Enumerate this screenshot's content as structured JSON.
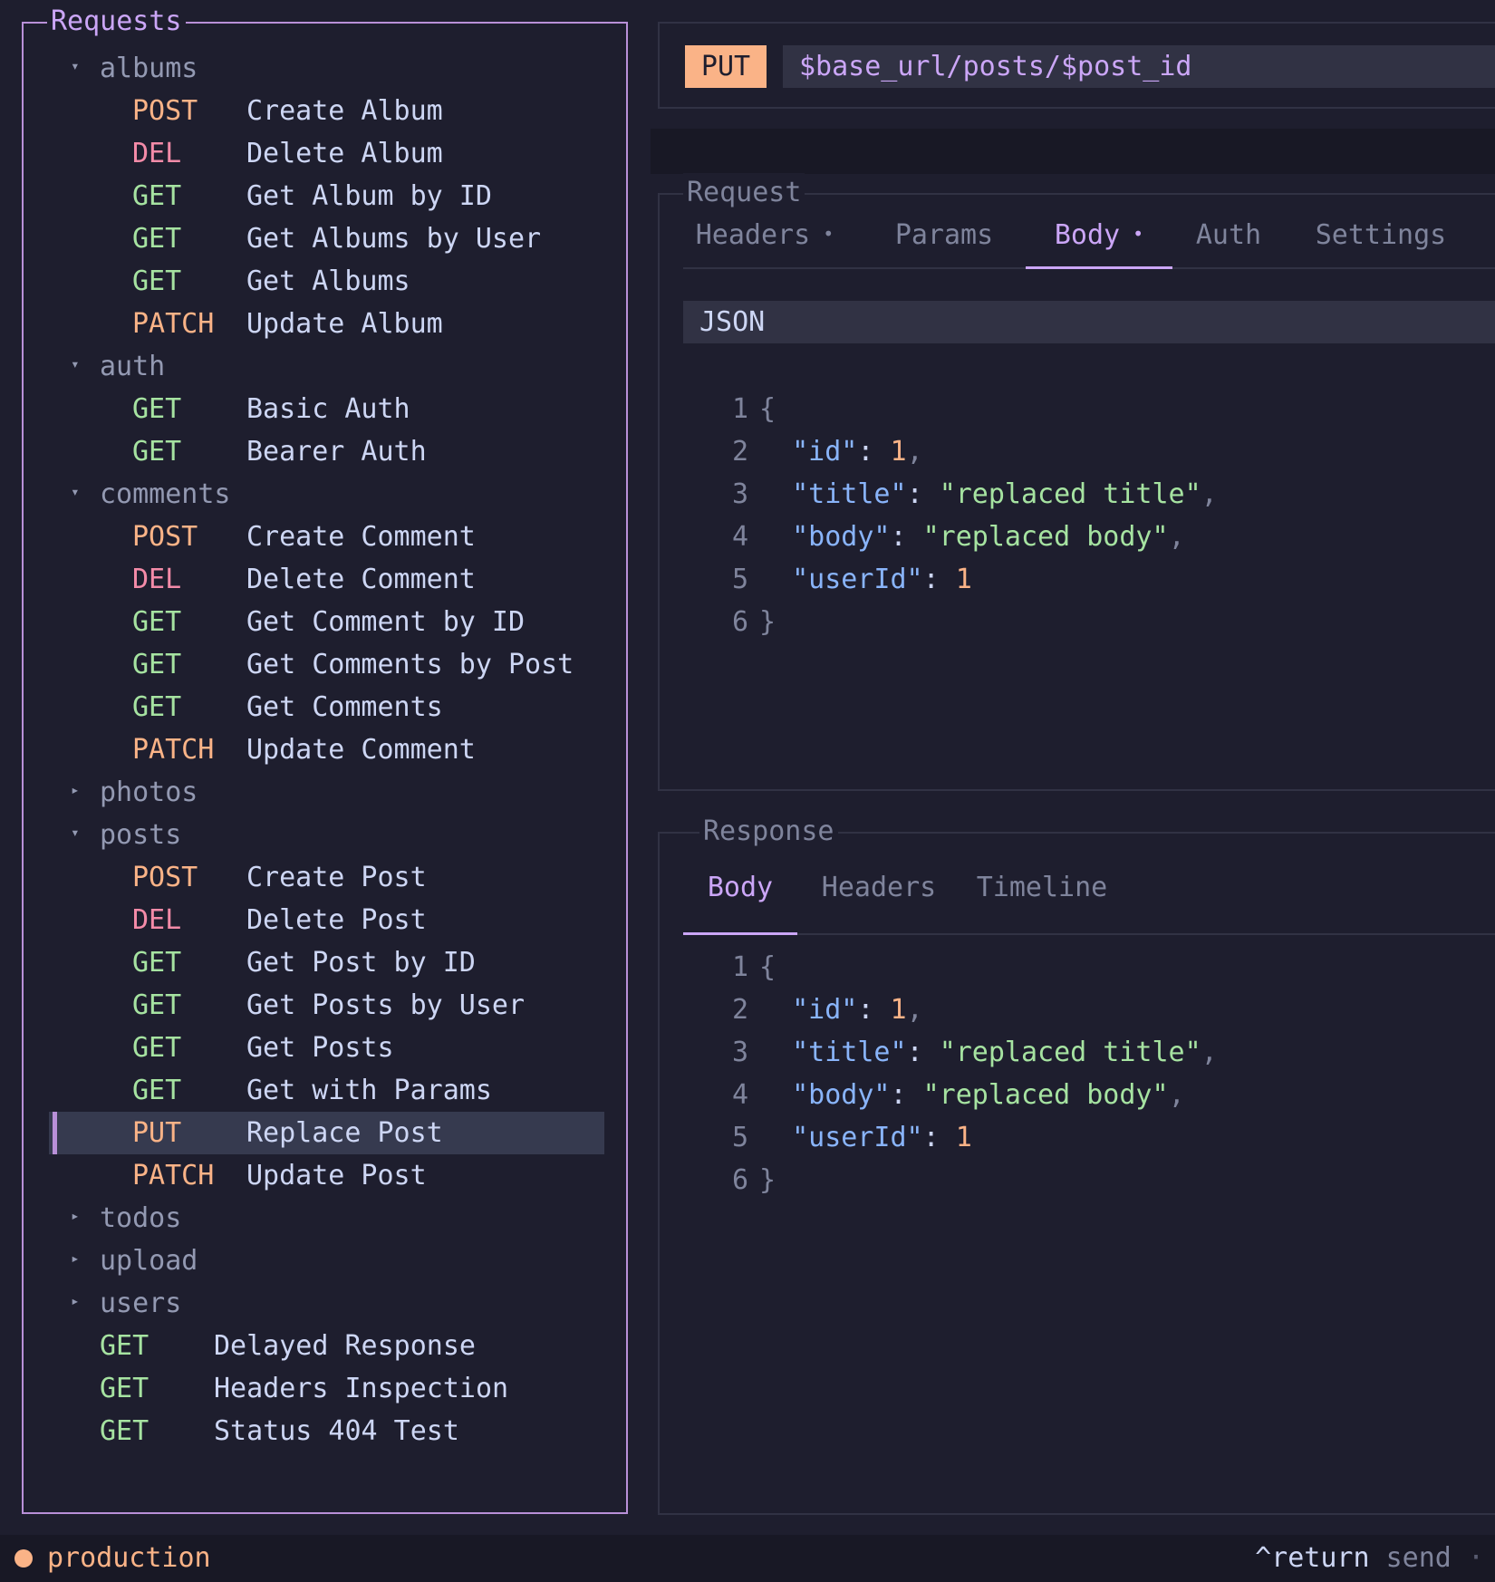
{
  "requests_panel": {
    "title": "Requests",
    "folders": [
      {
        "name": "albums",
        "expanded": true,
        "requests": [
          {
            "method": "POST",
            "name": "Create Album"
          },
          {
            "method": "DEL",
            "name": "Delete Album"
          },
          {
            "method": "GET",
            "name": "Get Album by ID"
          },
          {
            "method": "GET",
            "name": "Get Albums by User"
          },
          {
            "method": "GET",
            "name": "Get Albums"
          },
          {
            "method": "PATCH",
            "name": "Update Album"
          }
        ]
      },
      {
        "name": "auth",
        "expanded": true,
        "requests": [
          {
            "method": "GET",
            "name": "Basic Auth"
          },
          {
            "method": "GET",
            "name": "Bearer Auth"
          }
        ]
      },
      {
        "name": "comments",
        "expanded": true,
        "requests": [
          {
            "method": "POST",
            "name": "Create Comment"
          },
          {
            "method": "DEL",
            "name": "Delete Comment"
          },
          {
            "method": "GET",
            "name": "Get Comment by ID"
          },
          {
            "method": "GET",
            "name": "Get Comments by Post"
          },
          {
            "method": "GET",
            "name": "Get Comments"
          },
          {
            "method": "PATCH",
            "name": "Update Comment"
          }
        ]
      },
      {
        "name": "photos",
        "expanded": false,
        "requests": []
      },
      {
        "name": "posts",
        "expanded": true,
        "requests": [
          {
            "method": "POST",
            "name": "Create Post"
          },
          {
            "method": "DEL",
            "name": "Delete Post"
          },
          {
            "method": "GET",
            "name": "Get Post by ID"
          },
          {
            "method": "GET",
            "name": "Get Posts by User"
          },
          {
            "method": "GET",
            "name": "Get Posts"
          },
          {
            "method": "GET",
            "name": "Get with Params"
          },
          {
            "method": "PUT",
            "name": "Replace Post",
            "selected": true
          },
          {
            "method": "PATCH",
            "name": "Update Post"
          }
        ]
      },
      {
        "name": "todos",
        "expanded": false,
        "requests": []
      },
      {
        "name": "upload",
        "expanded": false,
        "requests": []
      },
      {
        "name": "users",
        "expanded": false,
        "requests": []
      }
    ],
    "root_requests": [
      {
        "method": "GET",
        "name": "Delayed Response"
      },
      {
        "method": "GET",
        "name": "Headers Inspection"
      },
      {
        "method": "GET",
        "name": "Status 404 Test"
      }
    ]
  },
  "url_bar": {
    "method": "PUT",
    "url": "$base_url/posts/$post_id"
  },
  "request_panel": {
    "title": "Request",
    "tabs": [
      {
        "label": "Headers",
        "dot": "•",
        "active": false
      },
      {
        "label": "Params",
        "dot": "",
        "active": false
      },
      {
        "label": "Body",
        "dot": "•",
        "active": true
      },
      {
        "label": "Auth",
        "dot": "",
        "active": false
      },
      {
        "label": "Settings",
        "dot": "",
        "active": false
      }
    ],
    "body_type": "JSON",
    "body_lines": [
      "{",
      "\"id\": 1,",
      "\"title\": \"replaced title\",",
      "\"body\": \"replaced body\",",
      "\"userId\": 1",
      "}"
    ],
    "line_numbers": [
      "1",
      "2",
      "3",
      "4",
      "5",
      "6"
    ]
  },
  "response_panel": {
    "title": "Response",
    "tabs": [
      {
        "label": "Body",
        "active": true
      },
      {
        "label": "Headers",
        "active": false
      },
      {
        "label": "Timeline",
        "active": false
      }
    ],
    "body_lines": [
      "{",
      "\"id\": 1,",
      "\"title\": \"replaced title\",",
      "\"body\": \"replaced body\",",
      "\"userId\": 1",
      "}"
    ],
    "line_numbers": [
      "1",
      "2",
      "3",
      "4",
      "5",
      "6"
    ]
  },
  "status_bar": {
    "environment": "production",
    "environment_color": "#fab387",
    "hint_key": "^return",
    "hint_action": "send",
    "hint_separator": "·"
  },
  "icons": {
    "expanded_caret": "caret-down-icon",
    "collapsed_caret": "caret-right-icon",
    "environment_indicator": "status-dot-icon"
  }
}
